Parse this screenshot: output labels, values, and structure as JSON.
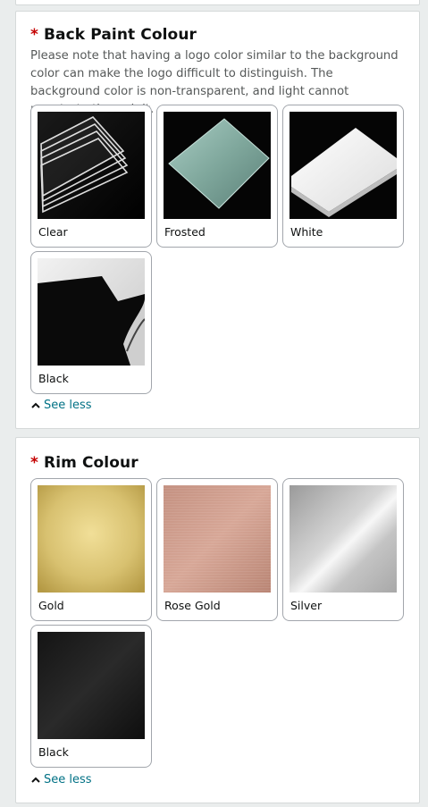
{
  "back_paint": {
    "required_marker": "*",
    "title": "Back Paint Colour",
    "note": "Please note that having a logo color similar to the background color can make the logo difficult to distinguish. The background color is non-transparent, and light cannot penetrate through it.",
    "options": [
      {
        "label": "Clear",
        "icon": "clear-acrylic-swatch"
      },
      {
        "label": "Frosted",
        "icon": "frosted-acrylic-swatch"
      },
      {
        "label": "White",
        "icon": "white-acrylic-swatch"
      },
      {
        "label": "Black",
        "icon": "black-acrylic-swatch"
      }
    ],
    "see_less": "See less"
  },
  "rim": {
    "required_marker": "*",
    "title": "Rim Colour",
    "options": [
      {
        "label": "Gold",
        "icon": "gold-swatch"
      },
      {
        "label": "Rose Gold",
        "icon": "rose-gold-swatch"
      },
      {
        "label": "Silver",
        "icon": "silver-swatch"
      },
      {
        "label": "Black",
        "icon": "black-metal-swatch"
      }
    ],
    "see_less": "See less"
  },
  "colors": {
    "required": "#c40000",
    "link": "#007185",
    "page_bg": "#eaeded",
    "tile_border": "#a2a6ac"
  }
}
